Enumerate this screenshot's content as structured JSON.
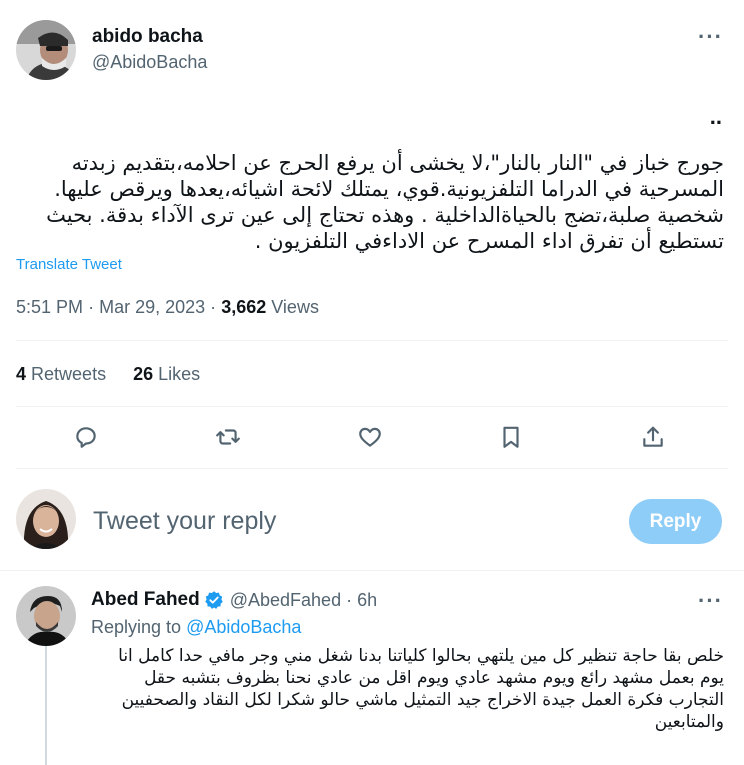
{
  "tweet": {
    "author": {
      "name": "abido bacha",
      "handle": "@AbidoBacha"
    },
    "more_label": "···",
    "dots": "..",
    "text": "جورج خباز في \"النار بالنار\"،لا يخشى أن يرفع الحرج عن احلامه،بتقديم زبدته المسرحية في الدراما التلفزيونية.قوي، يمتلك لائحة اشيائه،يعدها ويرقص عليها. شخصية صلبة،تضج بالحياةالداخلية . وهذه تحتاج إلى عين ترى الآداء بدقة. بحيث تستطيع أن تفرق اداء المسرح عن الاداءفي التلفزيون .",
    "translate_label": "Translate Tweet",
    "time": "5:51 PM",
    "separator": "·",
    "date": "Mar 29, 2023",
    "views_count": "3,662",
    "views_label": "Views",
    "retweets_count": "4",
    "retweets_label": "Retweets",
    "likes_count": "26",
    "likes_label": "Likes"
  },
  "actions": {
    "icons": [
      "reply-icon",
      "retweet-icon",
      "like-icon",
      "bookmark-icon",
      "share-icon"
    ]
  },
  "composer": {
    "placeholder": "Tweet your reply",
    "button_label": "Reply"
  },
  "reply": {
    "name": "Abed Fahed",
    "handle": "@AbedFahed",
    "separator": "·",
    "time": "6h",
    "replying_prefix": "Replying to",
    "replying_to": "@AbidoBacha",
    "more_label": "···",
    "text": "خلص بقا حاجة تنظير كل مين يلتهي بحالوا كلياتنا بدنا شغل مني وجر مافي حدا كامل انا يوم بعمل مشهد رائع ويوم مشهد عادي ويوم اقل من عادي نحنا بظروف بتشبه حقل التجارب  فكرة العمل جيدة الاخراج جيد التمثيل ماشي حالو شكرا لكل النقاد والصحفيين والمتابعين"
  },
  "colors": {
    "accent": "#1d9bf0",
    "secondary_text": "#536471",
    "reply_button": "#8ecdf8"
  }
}
